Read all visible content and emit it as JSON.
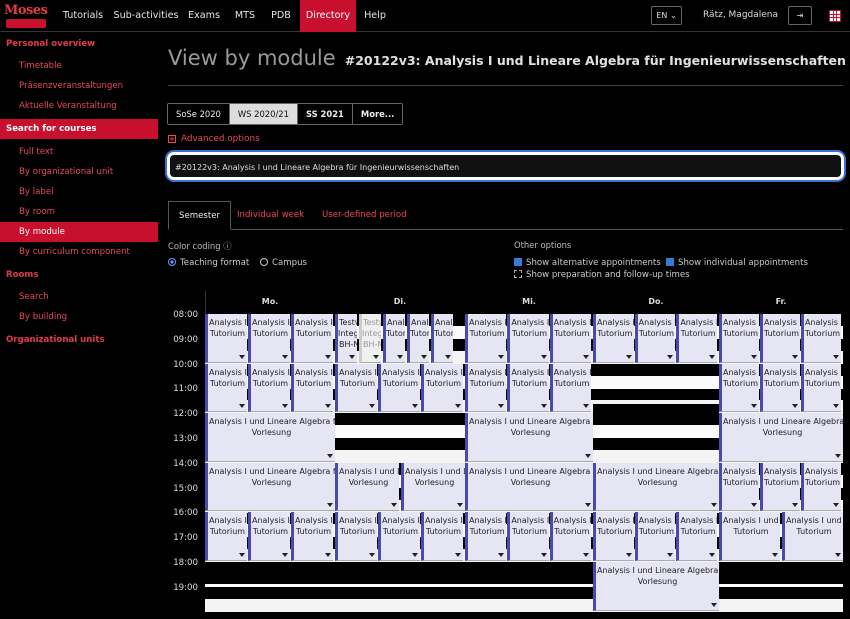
{
  "header": {
    "logo_text": "Moses",
    "nav": [
      "Tutorials",
      "Sub-activities",
      "Exams",
      "MTS",
      "PDB",
      "Directory",
      "Help"
    ],
    "active_nav": "Directory",
    "language": "EN",
    "user": "Rätz, Magdalena",
    "accent": "#c8102e"
  },
  "sidebar": {
    "sections": [
      {
        "label": "Personal overview",
        "items": [
          "Timetable",
          "Präsenzveranstaltungen",
          "Aktuelle Veranstaltung"
        ]
      },
      {
        "label": "Search for courses",
        "items": [
          "Full text",
          "By organizational unit",
          "By label",
          "By room",
          "By module",
          "By curriculum component"
        ]
      },
      {
        "label": "Rooms",
        "items": [
          "Search",
          "By building"
        ]
      },
      {
        "label": "Organizational units",
        "items": []
      }
    ],
    "active_item": "By module"
  },
  "main": {
    "title": "View by module",
    "subtitle": "#20122v3: Analysis I und Lineare Algebra für Ingenieurwissenschaften",
    "semesters": [
      "SoSe 2020",
      "WS 2020/21",
      "SS 2021",
      "More..."
    ],
    "active_semester": "WS 2020/21",
    "advanced_options": "Advanced options",
    "search_value": "#20122v3: Analysis I und Lineare Algebra für Ingenieurwissenschaften",
    "view_tabs": [
      "Semester",
      "Individual week",
      "User-defined period"
    ],
    "active_view_tab": "Semester",
    "color_coding": {
      "label": "Color coding",
      "options": [
        "Teaching format",
        "Campus"
      ],
      "selected": "Teaching format"
    },
    "other_options": {
      "label": "Other options",
      "items": [
        {
          "label": "Show alternative appointments",
          "checked": true
        },
        {
          "label": "Show individual appointments",
          "checked": true
        },
        {
          "label": "Show preparation and follow-up times",
          "checked": false
        }
      ]
    }
  },
  "calendar": {
    "days": [
      "Mo.",
      "Di.",
      "Mi.",
      "Do.",
      "Fr."
    ],
    "times": [
      "08:00",
      "09:00",
      "10:00",
      "11:00",
      "12:00",
      "13:00",
      "14:00",
      "15:00",
      "16:00",
      "17:00",
      "18:00",
      "19:00"
    ],
    "short_title": "Analysis I",
    "long_title": "Analysis I und Lineare Algebra für Ingenieurwissenschaften",
    "tutorial": "Tutorium",
    "lecture": "Vorlesung",
    "test_title": "Testv",
    "integ": "Integ",
    "room": "BH-N",
    "event_color": "#e5e5f4",
    "event_border": "#4a4aaa"
  }
}
